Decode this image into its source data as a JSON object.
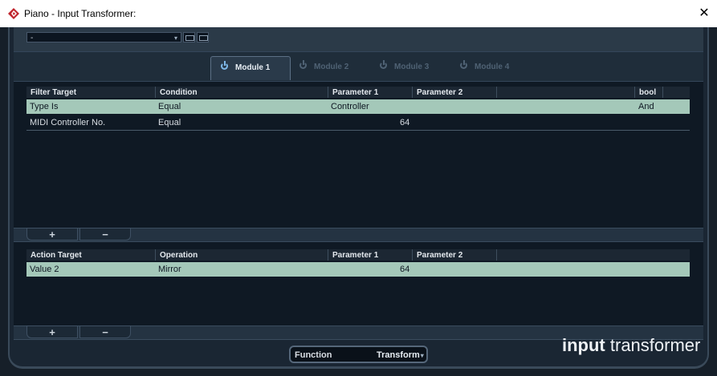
{
  "window": {
    "title": "Piano - Input Transformer:",
    "close_glyph": "✕",
    "app_icon": "cubase-logo-icon"
  },
  "toolbar": {
    "preset_value": "-",
    "preset_arrow": "▾"
  },
  "modules": [
    {
      "label": "Module 1",
      "active": true
    },
    {
      "label": "Module 2",
      "active": false
    },
    {
      "label": "Module 3",
      "active": false
    },
    {
      "label": "Module 4",
      "active": false
    }
  ],
  "filter": {
    "columns": [
      "Filter Target",
      "Condition",
      "Parameter 1",
      "Parameter 2",
      "bool"
    ],
    "rows": [
      {
        "target": "Type Is",
        "condition": "Equal",
        "param1": "Controller",
        "param2": "",
        "bool": "And",
        "selected": true
      },
      {
        "target": "MIDI Controller No.",
        "condition": "Equal",
        "param1": "64",
        "param2": "",
        "bool": "",
        "selected": false
      }
    ],
    "add_label": "+",
    "remove_label": "−"
  },
  "action": {
    "columns": [
      "Action Target",
      "Operation",
      "Parameter 1",
      "Parameter 2"
    ],
    "rows": [
      {
        "target": "Value 2",
        "operation": "Mirror",
        "param1": "64",
        "param2": "",
        "selected": true
      }
    ],
    "add_label": "+",
    "remove_label": "−"
  },
  "function": {
    "label": "Function",
    "value": "Transform"
  },
  "brand": {
    "bold": "input",
    "rest": " transformer"
  },
  "colors": {
    "selected_row": "#a4c8b9",
    "active_tab_icon": "#7fb8e8",
    "background": "#0e1722"
  }
}
